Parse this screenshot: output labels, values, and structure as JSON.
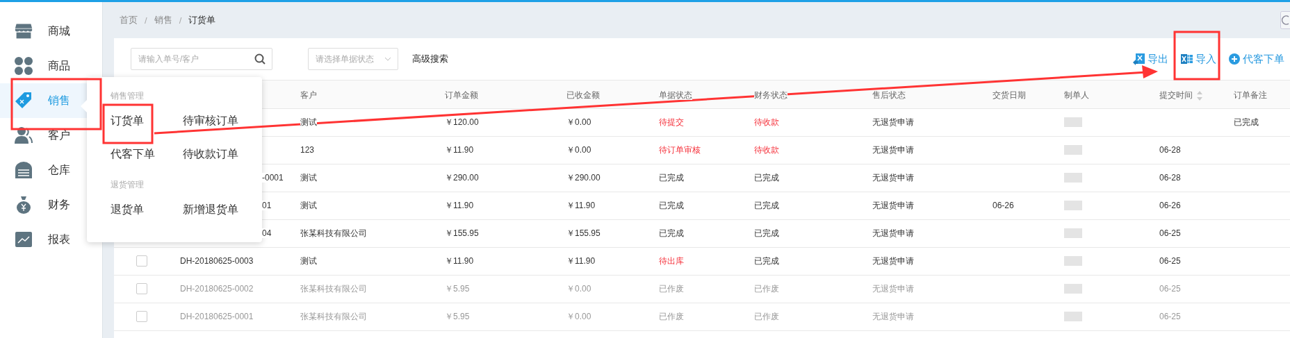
{
  "sidebar": {
    "items": [
      {
        "label": "商城",
        "selected": false
      },
      {
        "label": "商品",
        "selected": false
      },
      {
        "label": "销售",
        "selected": true
      },
      {
        "label": "客户",
        "selected": false
      },
      {
        "label": "仓库",
        "selected": false
      },
      {
        "label": "财务",
        "selected": false
      },
      {
        "label": "报表",
        "selected": false
      }
    ]
  },
  "breadcrumb": [
    "首页",
    "销售",
    "订货单"
  ],
  "breadcrumb_separator": "/",
  "popup_menu": {
    "groups": [
      {
        "title": "销售管理",
        "items": [
          "订货单",
          "待审核订单",
          "代客下单",
          "待收款订单"
        ]
      },
      {
        "title": "退货管理",
        "items": [
          "退货单",
          "新增退货单"
        ]
      }
    ]
  },
  "toolbar": {
    "search": {
      "placeholder": "请输入单号/客户"
    },
    "status_select": {
      "placeholder": "请选择单据状态"
    },
    "advanced_search": "高级搜索",
    "actions": [
      "导出",
      "导入",
      "代客下单"
    ]
  },
  "table": {
    "columns": [
      "客户",
      "订单金额",
      "已收金额",
      "单据状态",
      "财务状态",
      "售后状态",
      "交货日期",
      "制单人",
      "提交时间",
      "订单备注"
    ],
    "rows": [
      {
        "customer": "测试",
        "amount": "￥120.00",
        "received": "￥0.00",
        "doc_status": {
          "text": "待提交",
          "alert": true
        },
        "fin_status": {
          "text": "待收款",
          "alert": true
        },
        "after_sale": "无退货申请",
        "remark": "已完成",
        "voided": false
      },
      {
        "customer": "123",
        "amount": "￥11.90",
        "received": "￥0.00",
        "doc_status": {
          "text": "待订单审核",
          "alert": true
        },
        "fin_status": {
          "text": "待收款",
          "alert": true
        },
        "after_sale": "无退货申请",
        "submit_time": "06-28",
        "voided": false
      },
      {
        "order_no": "-0001",
        "customer": "测试",
        "amount": "￥290.00",
        "received": "￥290.00",
        "doc_status": {
          "text": "已完成",
          "alert": false
        },
        "fin_status": {
          "text": "已完成",
          "alert": false
        },
        "after_sale": "无退货申请",
        "submit_time": "06-28",
        "voided": false
      },
      {
        "order_no": "01",
        "customer": "测试",
        "amount": "￥11.90",
        "received": "￥11.90",
        "doc_status": {
          "text": "已完成",
          "alert": false
        },
        "fin_status": {
          "text": "已完成",
          "alert": false
        },
        "after_sale": "无退货申请",
        "delivery_date": "06-26",
        "submit_time": "06-26",
        "voided": false
      },
      {
        "order_no": "04",
        "customer": "张某科技有限公司",
        "amount": "￥155.95",
        "received": "￥155.95",
        "doc_status": {
          "text": "已完成",
          "alert": false
        },
        "fin_status": {
          "text": "已完成",
          "alert": false
        },
        "after_sale": "无退货申请",
        "submit_time": "06-25",
        "voided": false
      },
      {
        "order_no": "DH-20180625-0003",
        "customer": "测试",
        "amount": "￥11.90",
        "received": "￥11.90",
        "doc_status": {
          "text": "待出库",
          "alert": true
        },
        "fin_status": {
          "text": "已完成",
          "alert": false
        },
        "after_sale": "无退货申请",
        "submit_time": "06-25",
        "voided": false,
        "checked": false
      },
      {
        "order_no": "DH-20180625-0002",
        "customer": "张某科技有限公司",
        "amount": "￥5.95",
        "received": "￥0.00",
        "doc_status": {
          "text": "已作废",
          "alert": false
        },
        "fin_status": {
          "text": "已作废",
          "alert": false
        },
        "after_sale": "无退货申请",
        "submit_time": "06-25",
        "voided": true,
        "checked": false
      },
      {
        "order_no": "DH-20180625-0001",
        "customer": "张某科技有限公司",
        "amount": "￥5.95",
        "received": "￥0.00",
        "doc_status": {
          "text": "已作废",
          "alert": false
        },
        "fin_status": {
          "text": "已作废",
          "alert": false
        },
        "after_sale": "无退货申请",
        "submit_time": "06-25",
        "voided": true,
        "checked": false
      }
    ]
  }
}
